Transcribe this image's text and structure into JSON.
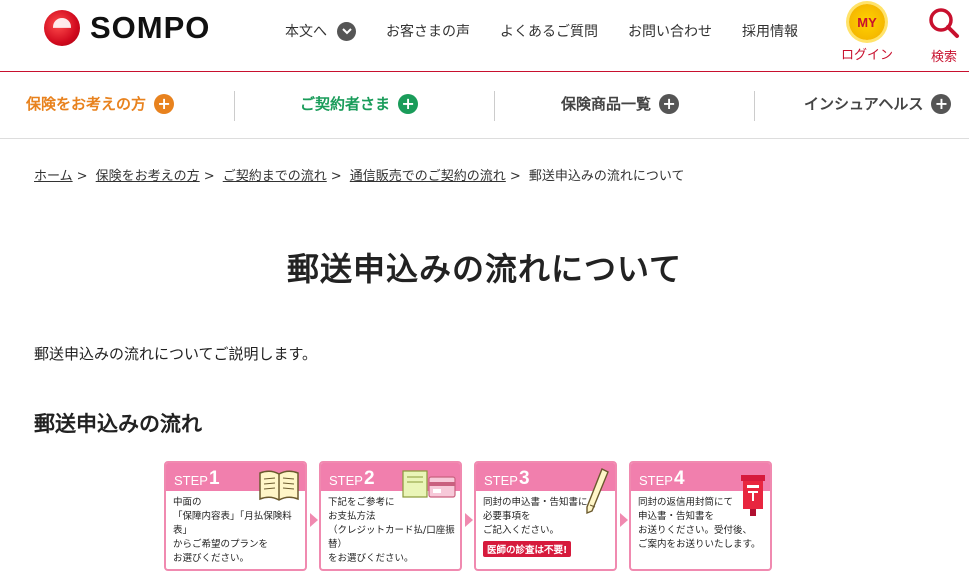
{
  "brand": {
    "name": "SOMPO",
    "accent": "#c8102e"
  },
  "topnav": [
    {
      "label": "本文へ",
      "icon": "chevron-down-icon"
    },
    {
      "label": "お客さまの声"
    },
    {
      "label": "よくあるご質問"
    },
    {
      "label": "お問い合わせ"
    },
    {
      "label": "採用情報"
    }
  ],
  "login": {
    "badge": "MY",
    "label": "ログイン"
  },
  "search": {
    "label": "検索"
  },
  "categories": [
    {
      "label": "保険をお考えの方",
      "color": "#e8821e"
    },
    {
      "label": "ご契約者さま",
      "color": "#1a9c5a"
    },
    {
      "label": "保険商品一覧",
      "color": "#444444"
    },
    {
      "label": "インシュアヘルス",
      "color": "#444444"
    }
  ],
  "breadcrumb": [
    "ホーム",
    "保険をお考えの方",
    "ご契約までの流れ",
    "通信販売でのご契約の流れ",
    "郵送申込みの流れについて"
  ],
  "page": {
    "title": "郵送申込みの流れについて",
    "lead": "郵送申込みの流れについてご説明します。",
    "section_title": "郵送申込みの流れ"
  },
  "steps": [
    {
      "label": "STEP",
      "num": "1",
      "text": "中面の\n「保障内容表」「月払保険料表」\nからご希望のプランを\nお選びください。"
    },
    {
      "label": "STEP",
      "num": "2",
      "text": "下記をご参考に\nお支払方法\n（クレジットカード払/口座振替）\nをお選びください。"
    },
    {
      "label": "STEP",
      "num": "3",
      "text": "同封の申込書・告知書に\n必要事項を\nご記入ください。",
      "note": "医師の診査は不要!"
    },
    {
      "label": "STEP",
      "num": "4",
      "text": "同封の返信用封筒にて\n申込書・告知書を\nお送りください。受付後、\nご案内をお送りいたします。"
    }
  ]
}
